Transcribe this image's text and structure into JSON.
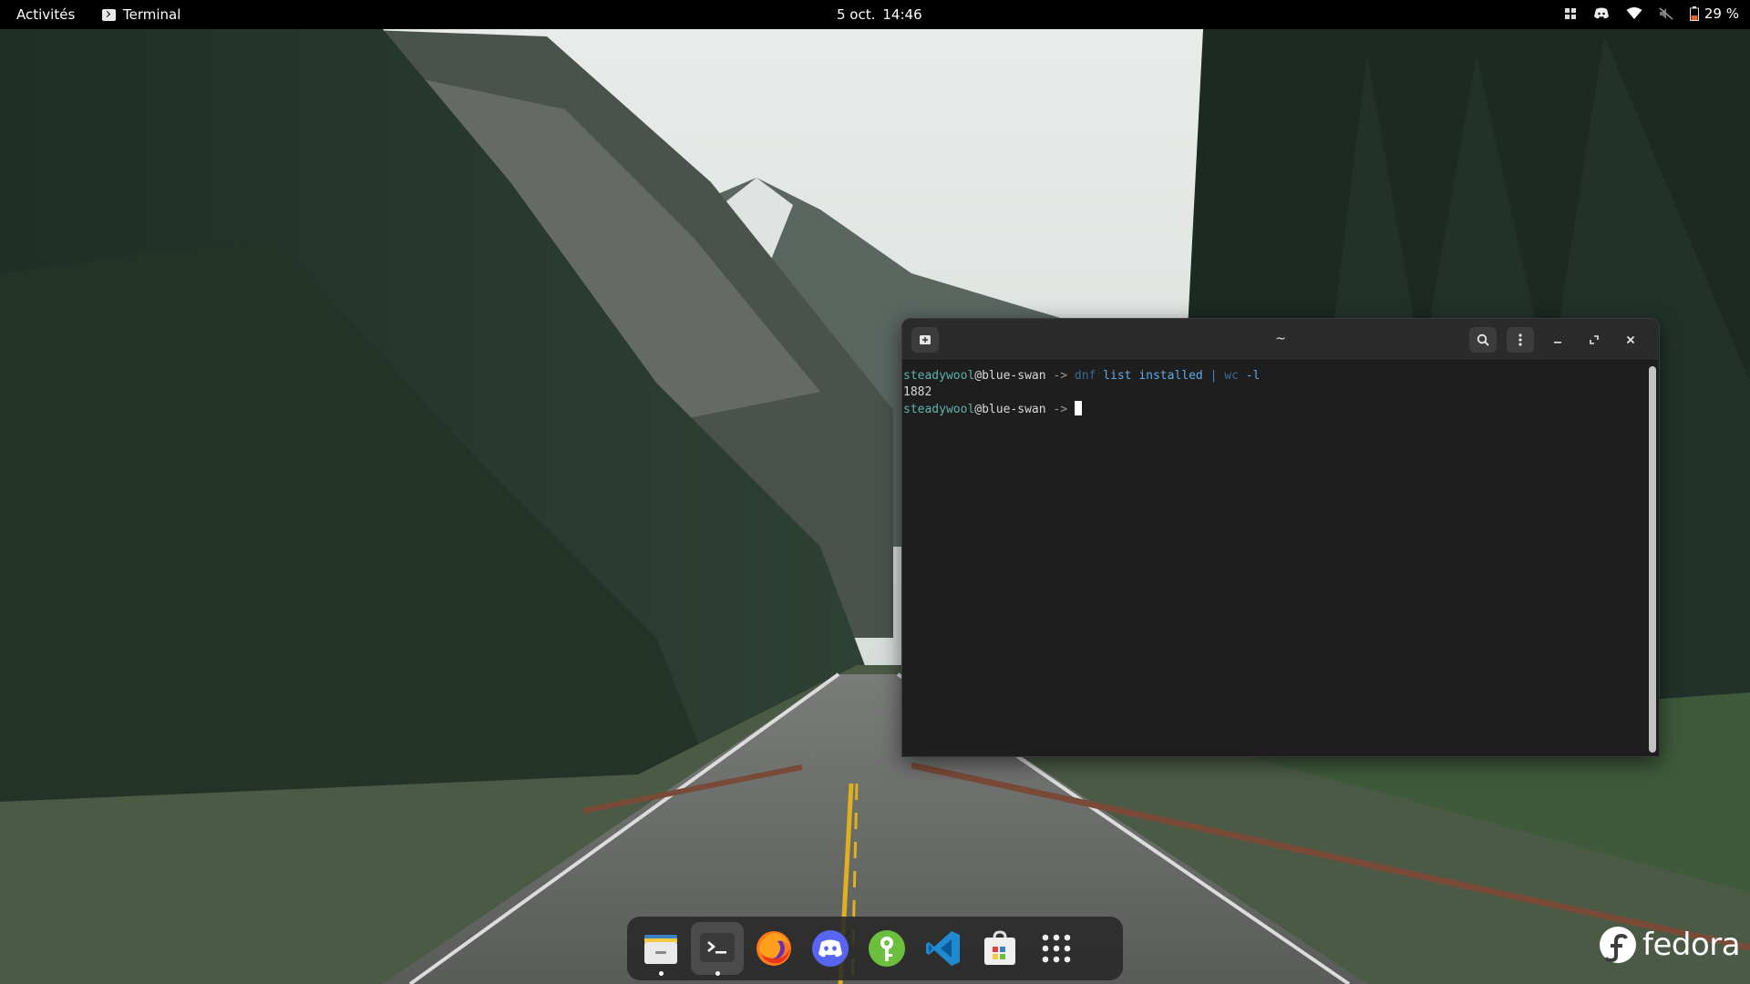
{
  "topbar": {
    "activities": "Activités",
    "app_name": "Terminal",
    "date": "5 oct.",
    "time": "14:46",
    "battery_percent": "29 %"
  },
  "terminal": {
    "title": "~",
    "lines": [
      {
        "user": "steadywool",
        "host": "@blue-swan",
        "arrow": " -> ",
        "cmd": "dnf",
        "args": " list installed ",
        "pipe": "|",
        "cmd2": " wc",
        "args2": " -l"
      },
      {
        "output": "1882"
      },
      {
        "user": "steadywool",
        "host": "@blue-swan",
        "arrow": " -> "
      }
    ]
  },
  "dock": {
    "items": [
      "files-icon",
      "terminal-icon",
      "firefox-icon",
      "discord-icon",
      "keepassxc-icon",
      "vscode-icon",
      "software-icon",
      "app-grid-icon"
    ]
  },
  "branding": {
    "word": "fedora"
  },
  "colors": {
    "topbar": "#000000",
    "terminal_bg": "#1e1e1e",
    "prompt_user": "#5fb3a8",
    "command": "#3a86c4",
    "discord": "#5865f2",
    "keepass": "#6cbf3c",
    "vscode": "#1f8ad2"
  }
}
